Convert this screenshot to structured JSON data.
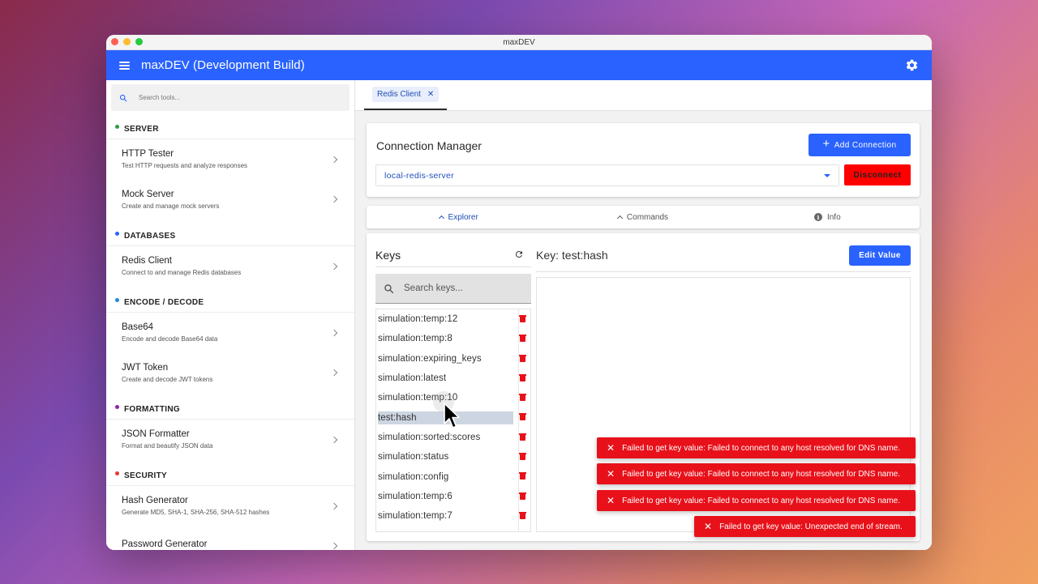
{
  "window": {
    "title": "maxDEV"
  },
  "appbar": {
    "title": "maxDEV (Development Build)"
  },
  "sidebar": {
    "search_placeholder": "Search tools...",
    "sections": [
      {
        "label": "SERVER",
        "color": "#2e9e44",
        "tools": [
          {
            "name": "HTTP Tester",
            "desc": "Test HTTP requests and analyze responses"
          },
          {
            "name": "Mock Server",
            "desc": "Create and manage mock servers"
          }
        ]
      },
      {
        "label": "DATABASES",
        "color": "#2962ff",
        "tools": [
          {
            "name": "Redis Client",
            "desc": "Connect to and manage Redis databases"
          }
        ]
      },
      {
        "label": "ENCODE / DECODE",
        "color": "#1e88e5",
        "tools": [
          {
            "name": "Base64",
            "desc": "Encode and decode Base64 data"
          },
          {
            "name": "JWT Token",
            "desc": "Create and decode JWT tokens"
          }
        ]
      },
      {
        "label": "FORMATTING",
        "color": "#8e24aa",
        "tools": [
          {
            "name": "JSON Formatter",
            "desc": "Format and beautify JSON data"
          }
        ]
      },
      {
        "label": "SECURITY",
        "color": "#e53935",
        "tools": [
          {
            "name": "Hash Generator",
            "desc": "Generate MD5, SHA-1, SHA-256, SHA-512 hashes"
          },
          {
            "name": "Password Generator",
            "desc": ""
          }
        ]
      }
    ]
  },
  "tabs": [
    {
      "label": "Redis Client",
      "close": "✕"
    }
  ],
  "connection": {
    "title": "Connection Manager",
    "add_label": "Add Connection",
    "selected": "local-redis-server",
    "disconnect_label": "Disconnect"
  },
  "subtabs": {
    "explorer": "Explorer",
    "commands": "Commands",
    "info": "Info"
  },
  "explorer": {
    "keys_title": "Keys",
    "search_placeholder": "Search keys...",
    "keys": [
      "simulation:temp:12",
      "simulation:temp:8",
      "simulation:expiring_keys",
      "simulation:latest",
      "simulation:temp:10",
      "test:hash",
      "simulation:sorted:scores",
      "simulation:status",
      "simulation:config",
      "simulation:temp:6",
      "simulation:temp:7"
    ],
    "selected_key_index": 5,
    "value_title": "Key: test:hash",
    "edit_label": "Edit Value"
  },
  "toasts": [
    "Failed to get key value: Failed to connect to any host resolved for DNS name.",
    "Failed to get key value: Failed to connect to any host resolved for DNS name.",
    "Failed to get key value: Failed to connect to any host resolved for DNS name.",
    "Failed to get key value: Unexpected end of stream."
  ],
  "colors": {
    "primary": "#2962ff",
    "danger": "#e8111a",
    "disconnect": "#ff0000"
  }
}
